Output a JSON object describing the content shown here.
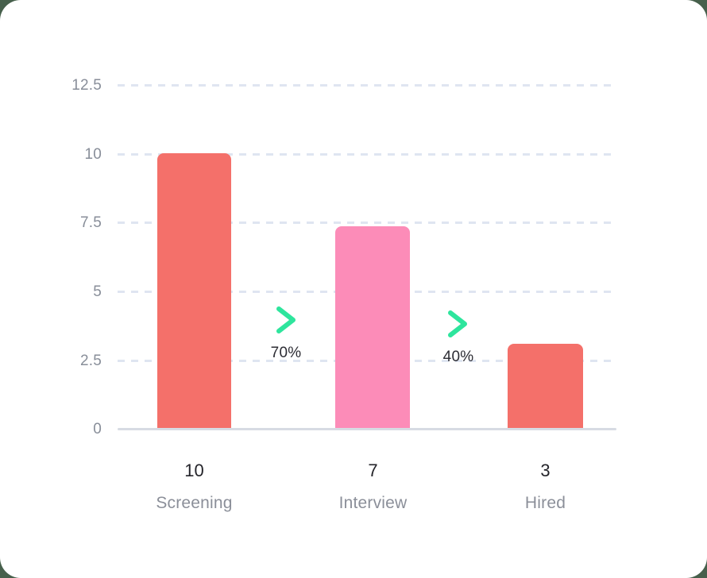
{
  "card": {
    "background_color": "#ffffff",
    "page_background_color": "#47604c"
  },
  "chart_data": {
    "type": "bar",
    "title": "",
    "subtitle": "",
    "xlabel": "",
    "ylabel": "",
    "categories": [
      "Screening",
      "Interview",
      "Hired"
    ],
    "values": [
      10,
      7,
      3
    ],
    "plotted_heights": [
      10,
      7.35,
      3.1
    ],
    "bar_colors": [
      "#f4706a",
      "#fc8cb8",
      "#f4706a"
    ],
    "ylim": [
      0,
      12.5
    ],
    "yticks": [
      "0",
      "2.5",
      "5",
      "7.5",
      "10",
      "12.5"
    ],
    "ytick_values": [
      0,
      2.5,
      5,
      7.5,
      10,
      12.5
    ],
    "grid": true,
    "grid_style": "dashed",
    "grid_color": "#dfe5f1",
    "axis_line_color": "#d7dbe3",
    "legend": "none",
    "annotations": [
      {
        "label": "70%",
        "icon": "chevron-right-icon",
        "color": "#2ee59d",
        "between": [
          "Screening",
          "Interview"
        ]
      },
      {
        "label": "40%",
        "icon": "chevron-right-icon",
        "color": "#2ee59d",
        "between": [
          "Interview",
          "Hired"
        ]
      }
    ],
    "data_labels": [
      "10",
      "7",
      "3"
    ]
  },
  "axis": {
    "y": {
      "t0": "0",
      "t1": "2.5",
      "t2": "5",
      "t3": "7.5",
      "t4": "10",
      "t5": "12.5"
    }
  },
  "categories": [
    {
      "value": "10",
      "label": "Screening"
    },
    {
      "value": "7",
      "label": "Interview"
    },
    {
      "value": "3",
      "label": "Hired"
    }
  ],
  "conversions": [
    {
      "percent": "70%"
    },
    {
      "percent": "40%"
    }
  ]
}
